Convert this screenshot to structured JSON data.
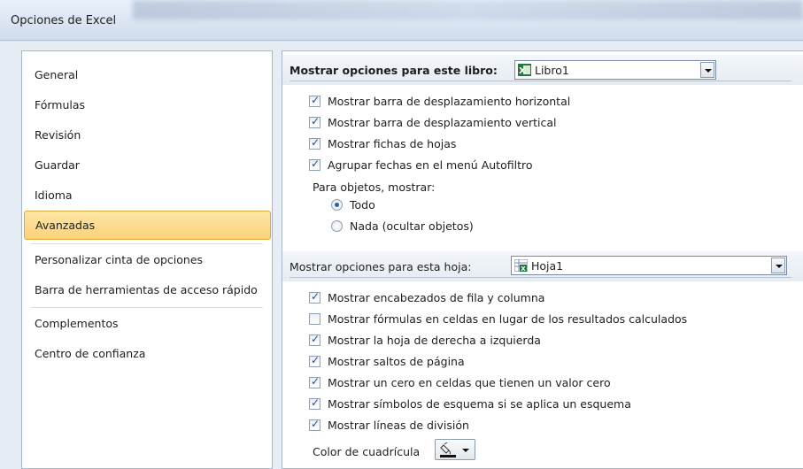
{
  "window": {
    "title": "Opciones de Excel"
  },
  "nav": {
    "items": [
      {
        "label": "General",
        "selected": false
      },
      {
        "label": "Fórmulas",
        "selected": false
      },
      {
        "label": "Revisión",
        "selected": false
      },
      {
        "label": "Guardar",
        "selected": false
      },
      {
        "label": "Idioma",
        "selected": false
      },
      {
        "label": "Avanzadas",
        "selected": true
      },
      {
        "label": "Personalizar cinta de opciones",
        "selected": false
      },
      {
        "label": "Barra de herramientas de acceso rápido",
        "selected": false
      },
      {
        "label": "Complementos",
        "selected": false
      },
      {
        "label": "Centro de confianza",
        "selected": false
      }
    ]
  },
  "workbook_section": {
    "label": "Mostrar opciones para este libro:",
    "combo_value": "Libro1",
    "options": [
      {
        "label": "Mostrar barra de desplazamiento horizontal",
        "checked": true
      },
      {
        "label": "Mostrar barra de desplazamiento vertical",
        "checked": true
      },
      {
        "label": "Mostrar fichas de hojas",
        "checked": true
      },
      {
        "label": "Agrupar fechas en el menú Autofiltro",
        "checked": true
      }
    ],
    "objects_label": "Para objetos, mostrar:",
    "radios": [
      {
        "label": "Todo",
        "selected": true
      },
      {
        "label": "Nada (ocultar objetos)",
        "selected": false
      }
    ]
  },
  "sheet_section": {
    "label": "Mostrar opciones para esta hoja:",
    "combo_value": "Hoja1",
    "options": [
      {
        "label": "Mostrar encabezados de fila y columna",
        "checked": true
      },
      {
        "label": "Mostrar fórmulas en celdas en lugar de los resultados calculados",
        "checked": false
      },
      {
        "label": "Mostrar la hoja de derecha a izquierda",
        "checked": true
      },
      {
        "label": "Mostrar saltos de página",
        "checked": true
      },
      {
        "label": "Mostrar un cero en celdas que tienen un valor cero",
        "checked": true
      },
      {
        "label": "Mostrar símbolos de esquema si se aplica un esquema",
        "checked": true
      },
      {
        "label": "Mostrar líneas de división",
        "checked": true
      }
    ],
    "gridline_color_label": "Color de cuadrícula"
  },
  "colors": {
    "selected_nav_bg": "#fbd27a",
    "selected_nav_border": "#e4a93b",
    "excel_green": "#1f7a3a",
    "panel_bg": "#e7edf5"
  },
  "icons": [
    "excel-workbook-icon",
    "excel-sheet-icon",
    "paint-bucket-icon",
    "dropdown-arrow-icon"
  ]
}
